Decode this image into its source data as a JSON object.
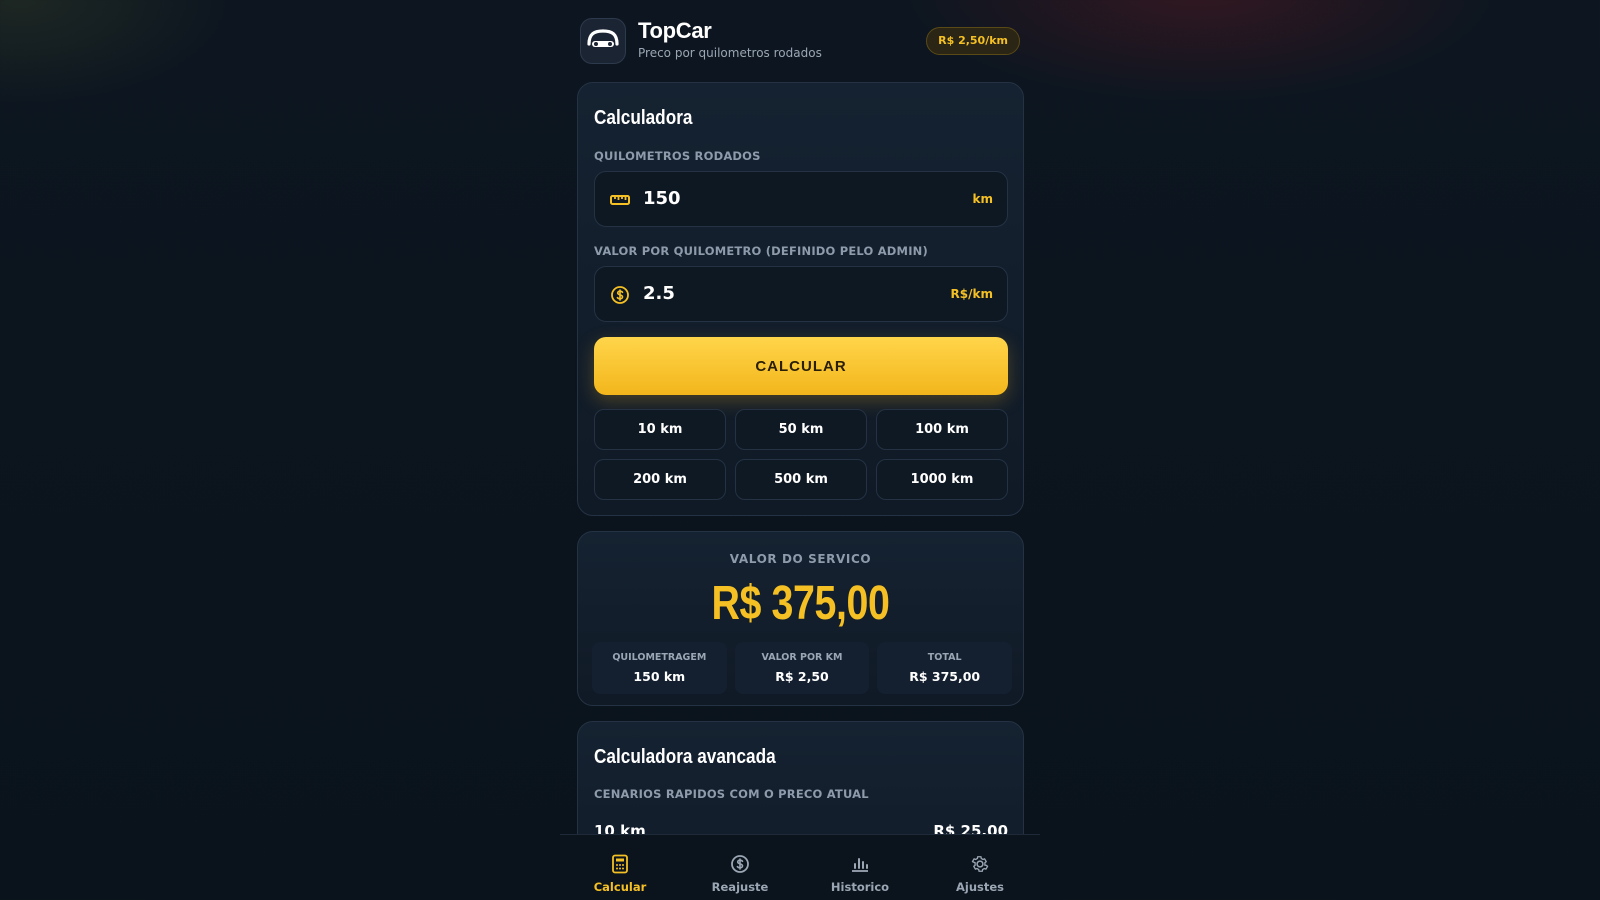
{
  "header": {
    "title": "TopCar",
    "subtitle": "Preco por quilometros rodados",
    "rate_badge": "R$ 2,50/km",
    "logo_icon": "car-icon"
  },
  "calculator": {
    "title": "Calculadora",
    "km_label": "QUILOMETROS RODADOS",
    "km_value": "150",
    "km_unit": "km",
    "km_icon": "ruler-icon",
    "price_label": "VALOR POR QUILOMETRO (DEFINIDO PELO ADMIN)",
    "price_value": "2.5",
    "price_unit": "R$/km",
    "price_icon": "dollar-circle-icon",
    "calc_button": "CALCULAR",
    "presets": [
      "10 km",
      "50 km",
      "100 km",
      "200 km",
      "500 km",
      "1000 km"
    ]
  },
  "result": {
    "label": "VALOR DO SERVICO",
    "value": "R$ 375,00",
    "stats": [
      {
        "key": "QUILOMETRAGEM",
        "value": "150 km"
      },
      {
        "key": "VALOR POR KM",
        "value": "R$ 2,50"
      },
      {
        "key": "TOTAL",
        "value": "R$ 375,00"
      }
    ]
  },
  "advanced": {
    "title": "Calculadora avancada",
    "subtitle": "CENARIOS RAPIDOS COM O PRECO ATUAL",
    "rows": [
      {
        "km": "10 km",
        "price": "R$ 25,00"
      }
    ]
  },
  "nav": {
    "items": [
      {
        "label": "Calcular",
        "icon": "calculator-icon",
        "active": true
      },
      {
        "label": "Reajuste",
        "icon": "dollar-circle-icon",
        "active": false
      },
      {
        "label": "Historico",
        "icon": "bar-chart-icon",
        "active": false
      },
      {
        "label": "Ajustes",
        "icon": "gear-icon",
        "active": false
      }
    ]
  },
  "colors": {
    "accent": "#f5c024",
    "background": "#0d1620",
    "card": "#152231"
  }
}
